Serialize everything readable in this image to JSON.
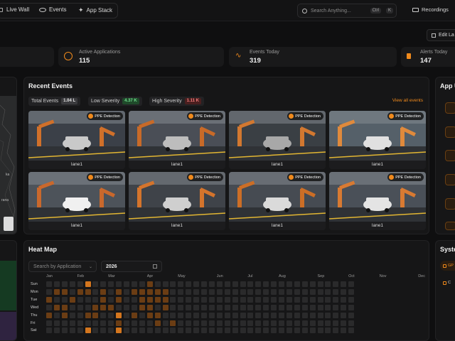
{
  "nav": {
    "items": [
      {
        "label": "Live Wall",
        "icon": "wall-icon"
      },
      {
        "label": "Events",
        "icon": "eye-icon"
      },
      {
        "label": "App Stack",
        "icon": "puzzle-icon"
      }
    ],
    "search_placeholder": "Search Anything...",
    "shortcut": [
      "Ctrl",
      "K"
    ],
    "recordings_label": "Recordings"
  },
  "edit_button_label": "Edit La",
  "stats": [
    {
      "label": "Active Applications",
      "value": "115",
      "icon": "apps-icon"
    },
    {
      "label": "Events Today",
      "value": "319",
      "icon": "pulse-icon"
    },
    {
      "label": "Alerts Today",
      "value": "147",
      "icon": "alert-icon"
    }
  ],
  "recent_events": {
    "title": "Recent Events",
    "view_all": "View all events",
    "chips": [
      {
        "label": "Total Events",
        "value": "1.04 L",
        "color": "#3a3a3d",
        "text": "#e6e6e6"
      },
      {
        "label": "Low Severity",
        "value": "4.37 K",
        "color": "#1f4a2a",
        "text": "#6fdc8c"
      },
      {
        "label": "High Severity",
        "value": "1.11 K",
        "color": "#4a1f1f",
        "text": "#f07a7a"
      }
    ],
    "cards": [
      {
        "tag": "PPE Detection",
        "label": "lane1"
      },
      {
        "tag": "PPE Detection",
        "label": "lane1"
      },
      {
        "tag": "PPE Detection",
        "label": "lane1"
      },
      {
        "tag": "PPE Detection",
        "label": "lane1"
      },
      {
        "tag": "PPE Detection",
        "label": "lane1"
      },
      {
        "tag": "PPE Detection",
        "label": "lane1"
      },
      {
        "tag": "PPE Detection",
        "label": "lane1"
      },
      {
        "tag": "PPE Detection",
        "label": "lane1"
      }
    ]
  },
  "heatmap": {
    "title": "Heat Map",
    "app_placeholder": "Search by Application",
    "year": "2026",
    "months": [
      "Jan",
      "Feb",
      "Mar",
      "Apr",
      "May",
      "Jun",
      "Jul",
      "Aug",
      "Sep",
      "Oct",
      "Nov",
      "Dec"
    ],
    "days": [
      "Sun",
      "Mon",
      "Tue",
      "Wed",
      "Thu",
      "Fri",
      "Sat"
    ],
    "levels": [
      [
        0,
        0,
        0,
        0,
        0,
        2,
        0,
        0,
        0,
        0,
        0,
        0,
        0,
        1,
        0,
        0,
        0,
        0,
        0,
        0,
        0,
        0,
        0,
        0,
        0,
        0,
        0,
        0,
        0,
        0,
        0,
        0,
        0,
        0,
        0,
        0,
        0,
        0,
        0,
        0
      ],
      [
        0,
        1,
        1,
        0,
        1,
        1,
        0,
        1,
        0,
        1,
        0,
        1,
        1,
        1,
        1,
        1,
        0,
        0,
        0,
        0,
        0,
        0,
        0,
        0,
        0,
        0,
        0,
        0,
        0,
        0,
        0,
        0,
        0,
        0,
        0,
        0,
        0,
        0,
        0,
        0
      ],
      [
        1,
        0,
        0,
        1,
        0,
        0,
        0,
        1,
        0,
        1,
        0,
        0,
        1,
        1,
        1,
        1,
        0,
        0,
        0,
        0,
        0,
        0,
        0,
        0,
        0,
        0,
        0,
        0,
        0,
        0,
        0,
        0,
        0,
        0,
        0,
        0,
        0,
        0,
        0,
        0
      ],
      [
        0,
        1,
        1,
        0,
        0,
        0,
        1,
        1,
        1,
        0,
        0,
        0,
        1,
        1,
        0,
        1,
        0,
        0,
        0,
        0,
        0,
        0,
        0,
        0,
        0,
        0,
        0,
        0,
        0,
        0,
        0,
        0,
        0,
        0,
        0,
        0,
        0,
        0,
        0,
        0
      ],
      [
        1,
        0,
        1,
        0,
        0,
        1,
        1,
        0,
        0,
        2,
        0,
        1,
        0,
        1,
        1,
        0,
        0,
        0,
        0,
        0,
        0,
        0,
        0,
        0,
        0,
        0,
        0,
        0,
        0,
        0,
        0,
        0,
        0,
        0,
        0,
        0,
        0,
        0,
        0,
        0
      ],
      [
        0,
        0,
        0,
        0,
        0,
        0,
        0,
        0,
        0,
        1,
        0,
        0,
        0,
        0,
        1,
        0,
        1,
        0,
        0,
        0,
        0,
        0,
        0,
        0,
        0,
        0,
        0,
        0,
        0,
        0,
        0,
        0,
        0,
        0,
        0,
        0,
        0,
        0,
        0,
        0
      ],
      [
        0,
        0,
        0,
        0,
        0,
        2,
        0,
        0,
        0,
        2,
        0,
        0,
        0,
        0,
        0,
        0,
        0,
        0,
        0,
        0,
        0,
        0,
        0,
        0,
        0,
        0,
        0,
        0,
        0,
        0,
        0,
        0,
        0,
        0,
        0,
        0,
        0,
        0,
        0,
        0
      ]
    ]
  },
  "app_panel_title": "App U",
  "system_panel_title": "Syste",
  "system_items": [
    "GP",
    "C"
  ],
  "map_labels": [
    "ka",
    "rana"
  ],
  "colors": {
    "accent": "#f08a1c",
    "bg": "#0f0f10",
    "panel": "#161617"
  }
}
